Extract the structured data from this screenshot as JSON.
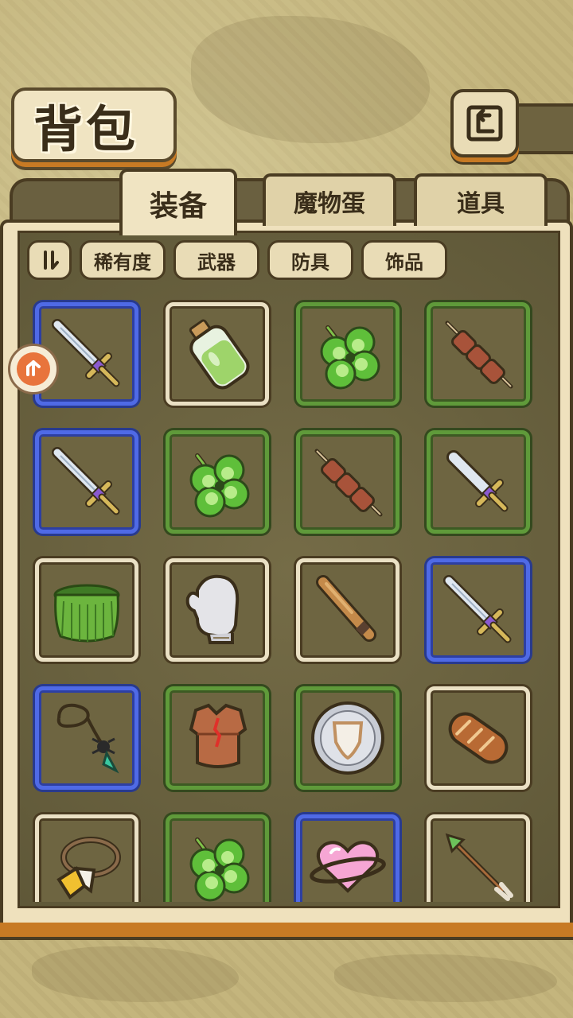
{
  "header": {
    "title": "背包"
  },
  "tabs": [
    {
      "label": "装备",
      "active": true
    },
    {
      "label": "魔物蛋",
      "active": false
    },
    {
      "label": "道具",
      "active": false
    }
  ],
  "filters": [
    {
      "label": "稀有度"
    },
    {
      "label": "武器"
    },
    {
      "label": "防具"
    },
    {
      "label": "饰品"
    }
  ],
  "colors": {
    "rarity_common": "#eae0c4",
    "rarity_uncommon": "#5f9a3a",
    "rarity_rare": "#4f6ae6",
    "accent": "#c77a24"
  },
  "items": [
    {
      "icon": "sword-icon",
      "rarity": "blue"
    },
    {
      "icon": "potion-icon",
      "rarity": "white"
    },
    {
      "icon": "clover-icon",
      "rarity": "green"
    },
    {
      "icon": "meat-skewer-icon",
      "rarity": "green"
    },
    {
      "icon": "sword-icon",
      "rarity": "blue"
    },
    {
      "icon": "clover-icon",
      "rarity": "green"
    },
    {
      "icon": "meat-skewer-icon",
      "rarity": "green"
    },
    {
      "icon": "short-sword-icon",
      "rarity": "green"
    },
    {
      "icon": "grass-skirt-icon",
      "rarity": "white"
    },
    {
      "icon": "mitten-icon",
      "rarity": "white"
    },
    {
      "icon": "wooden-club-icon",
      "rarity": "white"
    },
    {
      "icon": "sword-icon",
      "rarity": "blue"
    },
    {
      "icon": "spider-necklace-icon",
      "rarity": "blue"
    },
    {
      "icon": "leather-armor-icon",
      "rarity": "green"
    },
    {
      "icon": "round-shield-icon",
      "rarity": "green"
    },
    {
      "icon": "bread-icon",
      "rarity": "white"
    },
    {
      "icon": "beak-ring-icon",
      "rarity": "white"
    },
    {
      "icon": "clover-icon",
      "rarity": "green"
    },
    {
      "icon": "heart-planet-icon",
      "rarity": "blue"
    },
    {
      "icon": "arrow-icon",
      "rarity": "white"
    }
  ]
}
